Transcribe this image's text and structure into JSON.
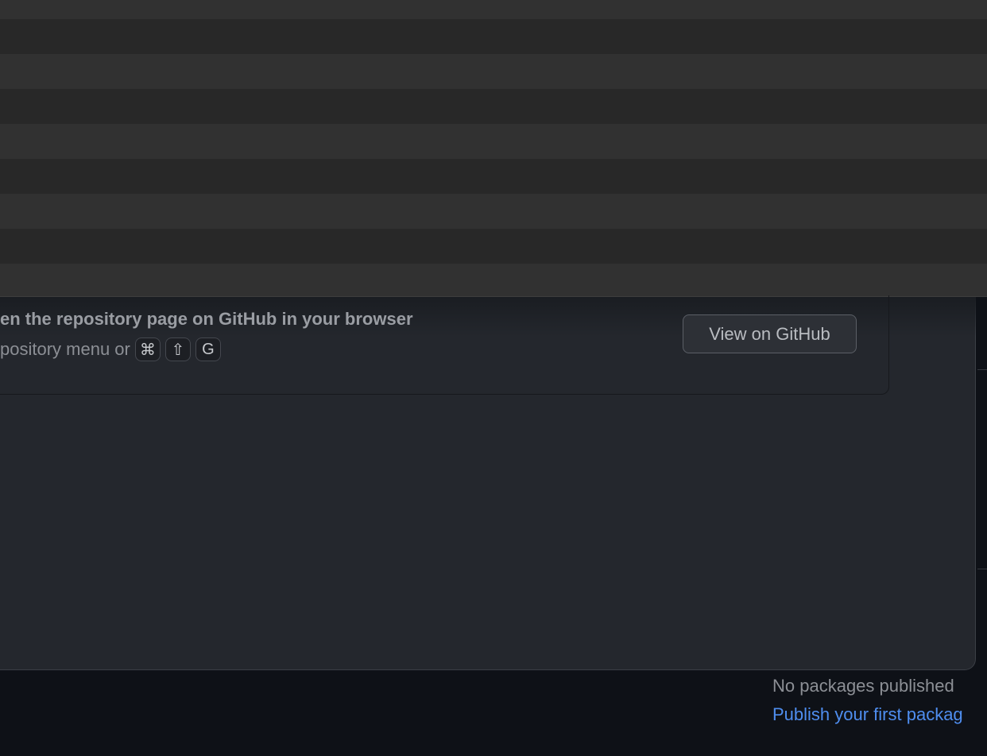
{
  "repo_card": {
    "title": "en the repository page on GitHub in your browser",
    "desc": "pository menu or",
    "shortcut": [
      "⌘",
      "⇧",
      "G"
    ],
    "button_label": "View on GitHub"
  },
  "sidebar": {
    "packages_status": "No packages published",
    "publish_link": "Publish your first packag"
  },
  "colors": {
    "background": "#0e1117",
    "panel": "#24272d",
    "link": "#4f8ef0"
  }
}
